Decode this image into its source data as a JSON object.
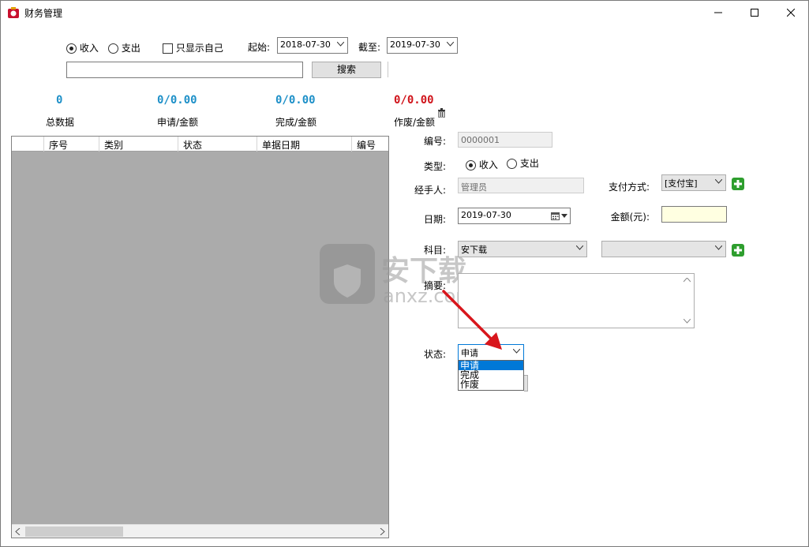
{
  "window": {
    "title": "财务管理"
  },
  "filter": {
    "income_label": "收入",
    "expense_label": "支出",
    "only_mine_label": "只显示自己",
    "start_label": "起始:",
    "start_date": "2018-07-30",
    "end_label": "截至:",
    "end_date": "2019-07-30",
    "search_value": "",
    "search_button": "搜索"
  },
  "stats": {
    "total_value": "0",
    "total_label": "总数据",
    "apply_value": "0/0.00",
    "apply_label": "申请/金额",
    "done_value": "0/0.00",
    "done_label": "完成/金额",
    "void_value": "0/0.00",
    "void_label": "作废/金额"
  },
  "grid": {
    "columns": [
      "",
      "序号",
      "类别",
      "状态",
      "单据日期",
      "编号"
    ]
  },
  "form": {
    "number_label": "编号:",
    "number_value": "0000001",
    "type_label": "类型:",
    "type_income": "收入",
    "type_expense": "支出",
    "handler_label": "经手人:",
    "handler_value": "管理员",
    "payment_label": "支付方式:",
    "payment_value": "[支付宝]",
    "date_label": "日期:",
    "date_value": "2019-07-30",
    "amount_label": "金额(元):",
    "amount_value": "",
    "subject_label": "科目:",
    "subject_value": "安下载",
    "subject2_value": "",
    "summary_label": "摘要:",
    "summary_value": "",
    "status_label": "状态:",
    "status_value": "申请",
    "status_options": [
      "申请",
      "完成",
      "作废"
    ]
  },
  "colors": {
    "stat_blue": "#1e90c8",
    "stat_red": "#d0141b",
    "selection": "#0078d7",
    "amount_bg": "#ffffe1",
    "grid_bg": "#ababab"
  },
  "icons": {
    "app": "finance-app-icon",
    "minimize": "minimize-icon",
    "maximize": "maximize-icon",
    "close": "close-icon",
    "trash": "trash-icon",
    "plus": "green-plus-icon",
    "calendar": "calendar-icon",
    "arrow": "red-arrow"
  }
}
